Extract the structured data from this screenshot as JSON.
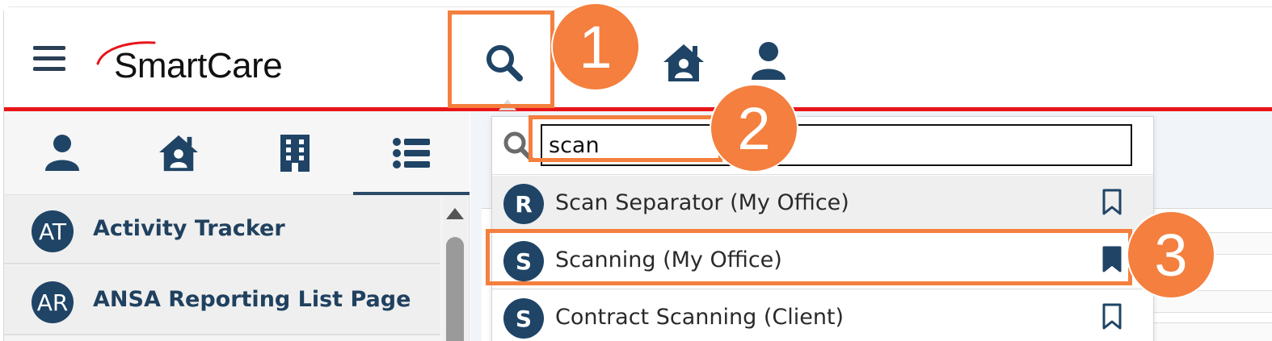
{
  "header": {
    "logo_text": "SmartCare",
    "icons": [
      "hamburger-icon",
      "search-icon",
      "home-icon",
      "user-icon"
    ]
  },
  "left_panel": {
    "tabs": [
      {
        "icon": "person-icon"
      },
      {
        "icon": "house-icon"
      },
      {
        "icon": "building-icon"
      },
      {
        "icon": "list-icon",
        "active": true
      }
    ],
    "items": [
      {
        "initials": "AT",
        "label": "Activity Tracker"
      },
      {
        "initials": "AR",
        "label": "ANSA Reporting List Page"
      }
    ]
  },
  "search": {
    "query": "scan",
    "results": [
      {
        "initial": "R",
        "label": "Scan Separator (My Office)",
        "bookmarked": false
      },
      {
        "initial": "S",
        "label": "Scanning (My Office)",
        "bookmarked": true
      },
      {
        "initial": "S",
        "label": "Contract Scanning (Client)",
        "bookmarked": false
      }
    ]
  },
  "callouts": {
    "step1": "1",
    "step2": "2",
    "step3": "3"
  },
  "colors": {
    "navy": "#1f4466",
    "accent_red": "#e8151a",
    "callout_orange": "#f47f3e"
  }
}
